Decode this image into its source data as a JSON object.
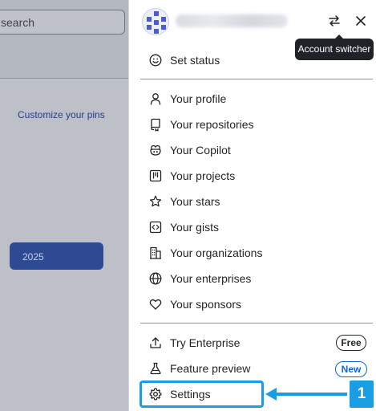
{
  "background": {
    "search_placeholder": "search",
    "pins_link": "Customize your pins",
    "year_button": "2025"
  },
  "header": {
    "username": "",
    "switch_icon": "arrow-switch-icon",
    "close_icon": "x-icon",
    "tooltip": "Account switcher"
  },
  "menu": {
    "set_status": "Set status",
    "profile": "Your profile",
    "repositories": "Your repositories",
    "copilot": "Your Copilot",
    "projects": "Your projects",
    "stars": "Your stars",
    "gists": "Your gists",
    "organizations": "Your organizations",
    "enterprises": "Your enterprises",
    "sponsors": "Your sponsors",
    "try_enterprise": "Try Enterprise",
    "free_badge": "Free",
    "feature_preview": "Feature preview",
    "new_badge": "New",
    "settings": "Settings"
  },
  "annotation": {
    "step_number": "1",
    "color": "#1a9ee3"
  },
  "colors": {
    "text": "#1f2328",
    "accent": "#0969da",
    "tooltip_bg": "#1f2328"
  }
}
